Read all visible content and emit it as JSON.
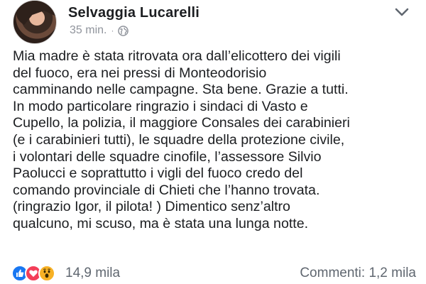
{
  "post": {
    "author": "Selvaggia Lucarelli",
    "time": "35 min.",
    "separator": "·",
    "privacy_icon": "globe-icon",
    "menu_icon": "chevron-down-icon",
    "body_lines": [
      "Mia madre è stata ritrovata ora dall’elicottero dei vigili",
      "del fuoco, era nei pressi di Monteodorisio",
      "camminando nelle campagne. Sta bene. Grazie a tutti.",
      "In modo particolare ringrazio i sindaci di Vasto e",
      "Cupello, la polizia, il maggiore Consales dei carabinieri",
      "(e i carabinieri tutti),  le squadre della protezione civile,",
      "i volontari delle squadre cinofile, l’assessore Silvio",
      "Paolucci e soprattutto i vigli del fuoco credo del",
      "comando provinciale di Chieti che l’hanno trovata.",
      "(ringrazio Igor, il pilota! ) Dimentico senz’altro",
      "qualcuno, mi scuso, ma è stata una lunga notte."
    ]
  },
  "footer": {
    "reactions": [
      "like-icon",
      "love-icon",
      "wow-icon"
    ],
    "reaction_count": "14,9 mila",
    "comments": "Commenti: 1,2 mila"
  },
  "colors": {
    "text": "#1c1e21",
    "meta": "#90949c",
    "like": "#1877f2",
    "love": "#f33e58",
    "wow": "#f7b125"
  }
}
